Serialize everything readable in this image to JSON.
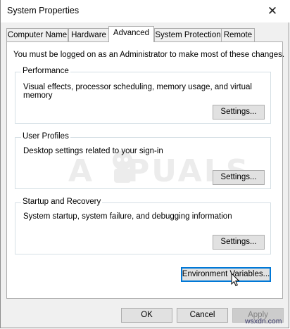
{
  "window": {
    "title": "System Properties",
    "close_glyph": "✕"
  },
  "tabs": [
    {
      "label": "Computer Name",
      "active": false
    },
    {
      "label": "Hardware",
      "active": false
    },
    {
      "label": "Advanced",
      "active": true
    },
    {
      "label": "System Protection",
      "active": false
    },
    {
      "label": "Remote",
      "active": false
    }
  ],
  "advanced": {
    "admin_note": "You must be logged on as an Administrator to make most of these changes.",
    "performance": {
      "label": "Performance",
      "description": "Visual effects, processor scheduling, memory usage, and virtual memory",
      "button": "Settings..."
    },
    "user_profiles": {
      "label": "User Profiles",
      "description": "Desktop settings related to your sign-in",
      "button": "Settings..."
    },
    "startup_recovery": {
      "label": "Startup and Recovery",
      "description": "System startup, system failure, and debugging information",
      "button": "Settings..."
    },
    "env_button": "Environment Variables..."
  },
  "footer": {
    "ok": "OK",
    "cancel": "Cancel",
    "apply": "Apply"
  },
  "watermark": {
    "left": "A",
    "right": "PUALS"
  },
  "site_label": "wsxdn.com",
  "colors": {
    "accent": "#0078d7",
    "tab_border": "#adadad",
    "group_border": "#d5dfe5"
  }
}
